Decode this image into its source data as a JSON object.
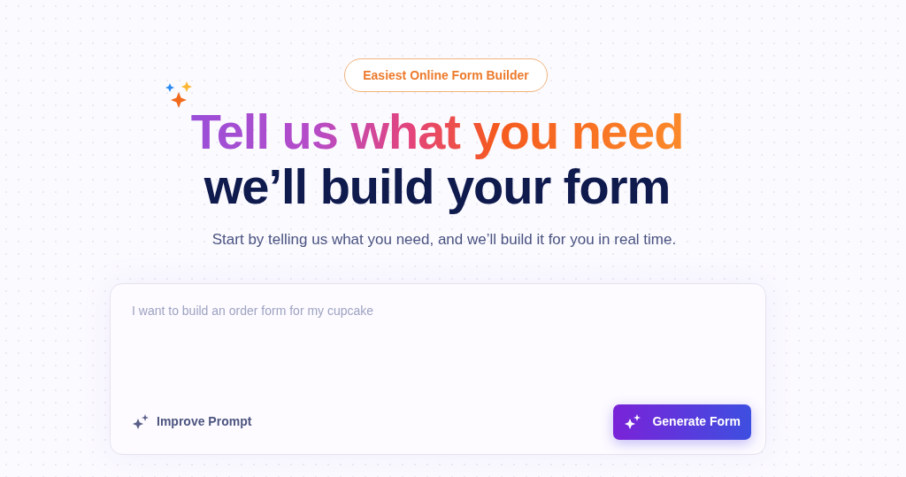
{
  "badge": "Easiest Online Form Builder",
  "headline": {
    "line_1": "Tell us what you need",
    "line_2": "we’ll build your form"
  },
  "subtitle": "Start by telling us what you need, and we’ll build it for you in real time.",
  "prompt_box": {
    "placeholder": "I want to build an order form for my cupcake",
    "improve_button": "Improve Prompt",
    "generate_button": "Generate Form"
  }
}
